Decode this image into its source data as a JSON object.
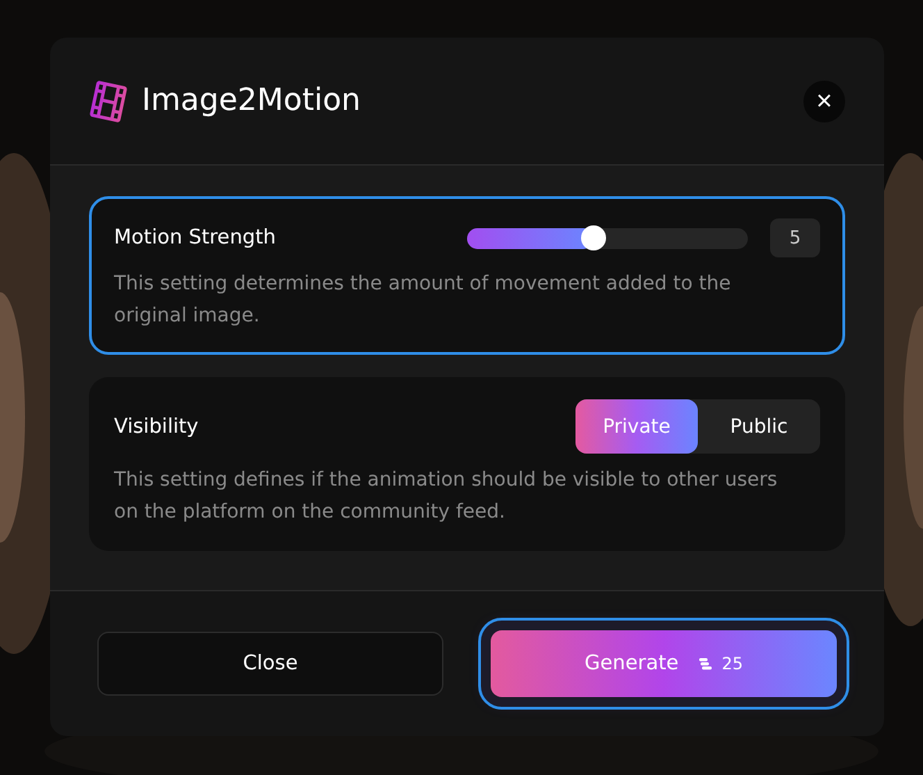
{
  "dialog": {
    "title": "Image2Motion",
    "close_icon": "×"
  },
  "settings": [
    {
      "kind": "slider",
      "label": "Motion Strength",
      "description": "This setting determines the amount of movement added to the original image.",
      "level": 0.45,
      "value": "5",
      "focused": true
    },
    {
      "kind": "toggle",
      "label": "Visibility",
      "description": "This setting defines if the animation should be visible to other users on the platform on the community feed.",
      "options": [
        {
          "label": "Private",
          "selected": true
        },
        {
          "label": "Public",
          "selected": false
        }
      ],
      "focused": false
    }
  ],
  "footer": {
    "close_button": {
      "label": "Close",
      "focused": false
    },
    "generate_button": {
      "label": "Generate",
      "credits": "25",
      "focused": true
    }
  }
}
